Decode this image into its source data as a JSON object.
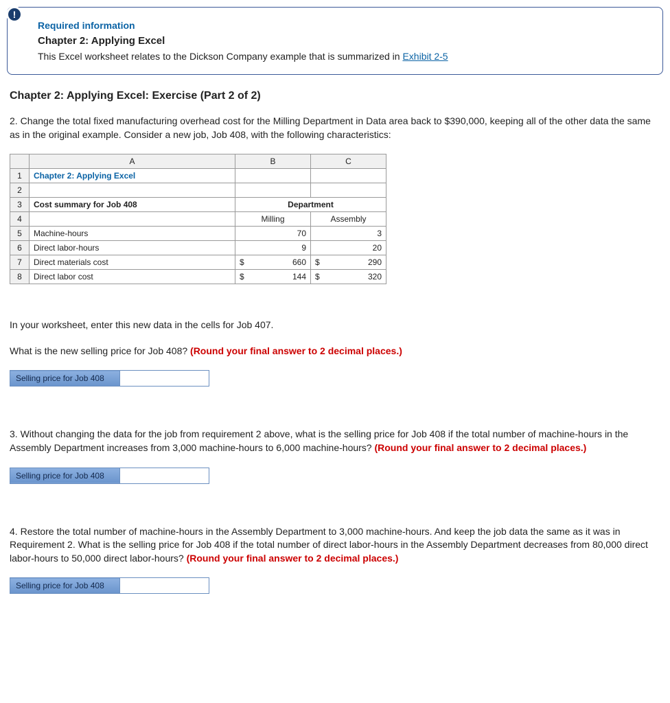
{
  "infoCard": {
    "reqLabel": "Required information",
    "chapterTitle": "Chapter 2: Applying Excel",
    "descPrefix": "This Excel worksheet relates to the Dickson Company example that is summarized in ",
    "exhibitLink": "Exhibit 2-5"
  },
  "sectionHeading": "Chapter 2: Applying Excel: Exercise (Part 2 of 2)",
  "q2": {
    "num": "2.",
    "text": " Change the total fixed manufacturing overhead cost for the Milling Department in Data area back to $390,000, keeping all of the other data the same as in the original example. Consider a new job, Job 408, with the following characteristics:"
  },
  "sheet": {
    "colA": "A",
    "colB": "B",
    "colC": "C",
    "rows": [
      "1",
      "2",
      "3",
      "4",
      "5",
      "6",
      "7",
      "8"
    ],
    "r1A": "Chapter 2: Applying Excel",
    "r3A": "Cost summary for Job 408",
    "r3BC": "Department",
    "r4B": "Milling",
    "r4C": "Assembly",
    "r5A": "Machine-hours",
    "r5B": "70",
    "r5C": "3",
    "r6A": "Direct labor-hours",
    "r6B": "9",
    "r6C": "20",
    "r7A": "Direct materials cost",
    "r7B": "660",
    "r7C": "290",
    "r8A": "Direct labor cost",
    "r8B": "144",
    "r8C": "320",
    "dollar": "$"
  },
  "postSheet1": "In your worksheet, enter this new data in the cells for Job 407.",
  "postSheet2Prefix": "What is the new selling price for Job 408? ",
  "roundNote": "(Round your final answer to 2 decimal places.)",
  "answerLabel": "Selling price for Job 408",
  "q3": {
    "num": "3.",
    "textPrefix": " Without changing the data for the job from requirement 2 above, what is the selling price for Job 408 if the total number of machine-hours in the Assembly Department increases from 3,000 machine-hours to 6,000 machine-hours? ",
    "roundNote": "(Round your final answer to 2 decimal places.)"
  },
  "q4": {
    "num": "4.",
    "textPrefix": " Restore the total number of machine-hours in the Assembly Department to 3,000 machine-hours. And keep the job data the same as it was in Requirement 2. What is the selling price for Job 408 if the total number of direct labor-hours in the Assembly Department decreases from 80,000 direct labor-hours to 50,000 direct labor-hours? ",
    "roundNote": "(Round your final answer to 2 decimal places.)"
  }
}
